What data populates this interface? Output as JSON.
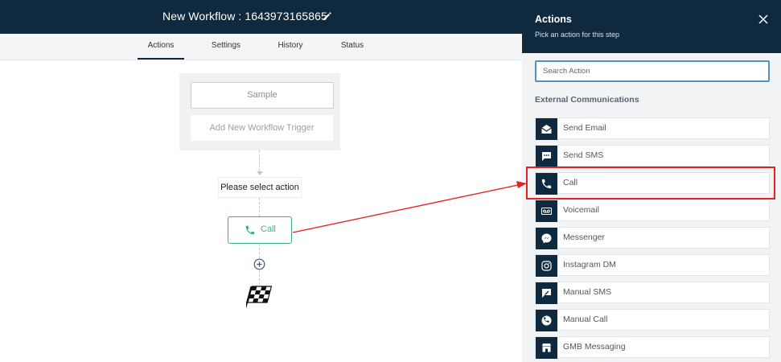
{
  "workflow": {
    "title": "New Workflow : 1643973165865"
  },
  "tabs": [
    {
      "label": "Actions",
      "active": true
    },
    {
      "label": "Settings",
      "active": false
    },
    {
      "label": "History",
      "active": false
    },
    {
      "label": "Status",
      "active": false
    }
  ],
  "canvas": {
    "trigger_sample": "Sample",
    "trigger_add": "Add New Workflow Trigger",
    "select_action": "Please select action",
    "call_node_label": "Call"
  },
  "panel": {
    "title": "Actions",
    "subtitle": "Pick an action for this step",
    "search_placeholder": "Search Action",
    "section_label": "External Communications",
    "actions": [
      {
        "label": "Send Email",
        "icon": "email-icon"
      },
      {
        "label": "Send SMS",
        "icon": "sms-icon"
      },
      {
        "label": "Call",
        "icon": "phone-icon"
      },
      {
        "label": "Voicemail",
        "icon": "voicemail-icon"
      },
      {
        "label": "Messenger",
        "icon": "messenger-icon"
      },
      {
        "label": "Instagram DM",
        "icon": "instagram-icon"
      },
      {
        "label": "Manual SMS",
        "icon": "manual-sms-icon"
      },
      {
        "label": "Manual Call",
        "icon": "manual-call-icon"
      },
      {
        "label": "GMB Messaging",
        "icon": "gmb-icon"
      }
    ]
  },
  "colors": {
    "header_bg": "#0f2a3e",
    "accent_green": "#37b28c",
    "highlight_red": "#e02424",
    "search_border": "#4f93c6"
  }
}
